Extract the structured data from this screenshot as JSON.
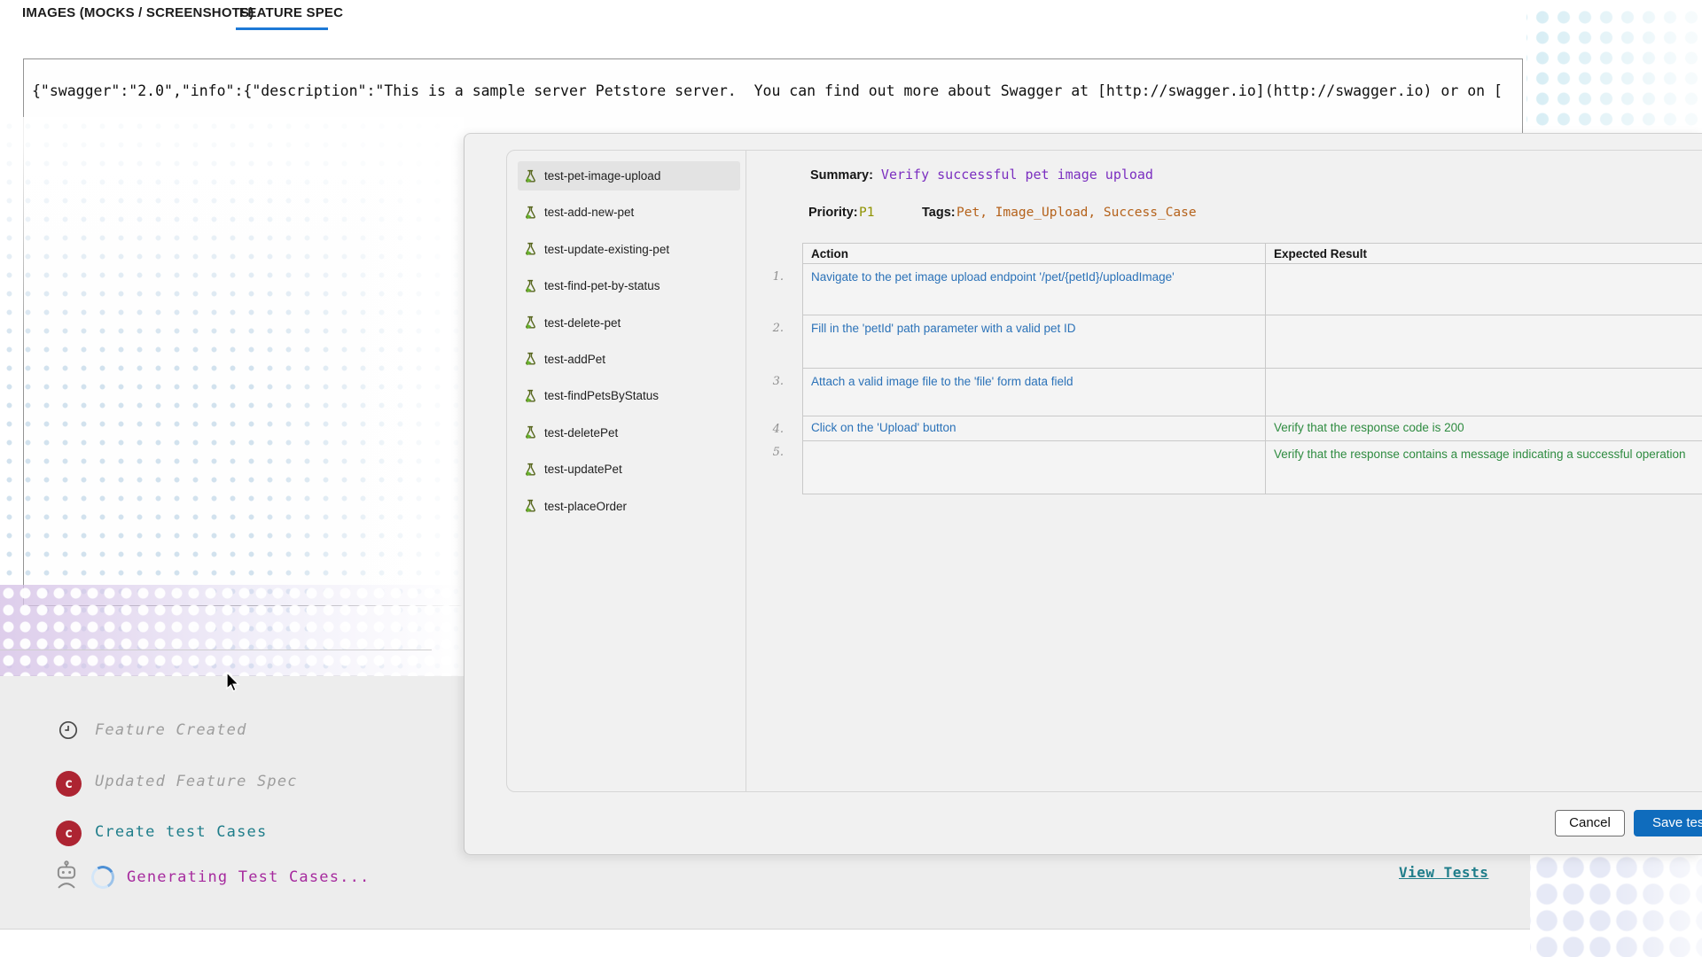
{
  "tabs": {
    "images_label": "IMAGES (MOCKS / SCREENSHOTS)",
    "feature_label": "FEATURE SPEC",
    "active": "FEATURE SPEC"
  },
  "spec": {
    "text": "{\"swagger\":\"2.0\",\"info\":{\"description\":\"This is a sample server Petstore server.  You can find out more about Swagger at [http://swagger.io](http://swagger.io) or on ["
  },
  "dialog": {
    "tests": [
      {
        "label": "test-pet-image-upload",
        "selected": true
      },
      {
        "label": "test-add-new-pet",
        "selected": false
      },
      {
        "label": "test-update-existing-pet",
        "selected": false
      },
      {
        "label": "test-find-pet-by-status",
        "selected": false
      },
      {
        "label": "test-delete-pet",
        "selected": false
      },
      {
        "label": "test-addPet",
        "selected": false
      },
      {
        "label": "test-findPetsByStatus",
        "selected": false
      },
      {
        "label": "test-deletePet",
        "selected": false
      },
      {
        "label": "test-updatePet",
        "selected": false
      },
      {
        "label": "test-placeOrder",
        "selected": false
      }
    ],
    "detail": {
      "summary_label": "Summary:",
      "summary": "Verify successful pet image upload",
      "priority_label": "Priority:",
      "priority": "P1",
      "tags_label": "Tags:",
      "tags": "Pet, Image_Upload, Success_Case",
      "table": {
        "headers": [
          "Action",
          "Expected Result"
        ],
        "rows": [
          {
            "num": "1.",
            "action": "Navigate to the pet image upload endpoint '/pet/{petId}/uploadImage'",
            "expected": ""
          },
          {
            "num": "2.",
            "action": "Fill in the 'petId' path parameter with a valid pet ID",
            "expected": ""
          },
          {
            "num": "3.",
            "action": "Attach a valid image file to the 'file' form data field",
            "expected": ""
          },
          {
            "num": "4.",
            "action": "Click on the 'Upload' button",
            "expected": "Verify that the response code is 200"
          },
          {
            "num": "5.",
            "action": "",
            "expected": "Verify that the response contains a message indicating a successful operation"
          }
        ]
      }
    },
    "buttons": {
      "cancel": "Cancel",
      "save": "Save tests"
    }
  },
  "timeline": {
    "item1": {
      "icon": "clock",
      "label": "Feature Created"
    },
    "item2": {
      "icon": "commit-c",
      "label": "Updated Feature Spec"
    },
    "item3": {
      "icon": "commit-c",
      "label": "Create test Cases"
    },
    "item4": {
      "icon": "robot+spinner",
      "label": "Generating Test Cases..."
    },
    "badge_letter": "c"
  },
  "view_tests_label": "View Tests",
  "colors": {
    "tab_underline_blue": "#1d79d6",
    "summary_purple": "#7b2fc0",
    "priority_olive": "#8f9300",
    "tags_orange": "#b5621b",
    "action_blue": "#2b72b8",
    "expected_green": "#2e8b40",
    "test_icon_green": "#69b42e",
    "timeline_red": "#ad2432",
    "timeline_teal": "#1f7d8a",
    "timeline_magenta": "#a62a9e",
    "save_button_blue": "#0f6cbd",
    "dialog_gray": "#f1f1f1"
  }
}
